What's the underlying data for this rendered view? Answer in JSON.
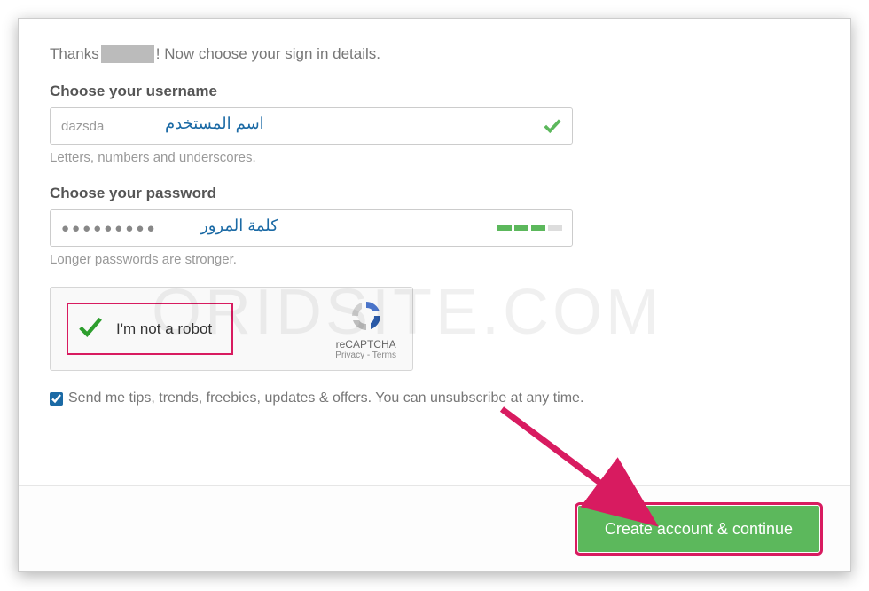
{
  "greeting": {
    "prefix": "Thanks",
    "suffix": "! Now choose your sign in details."
  },
  "username": {
    "label": "Choose your username",
    "value": "dazsda",
    "arabic": "اسم المستخدم",
    "hint": "Letters, numbers and underscores."
  },
  "password": {
    "label": "Choose your password",
    "masked": "●●●●●●●●●",
    "arabic": "كلمة المرور",
    "hint": "Longer passwords are stronger."
  },
  "captcha": {
    "text": "I'm not a robot",
    "brand": "reCAPTCHA",
    "links": "Privacy - Terms"
  },
  "tips": {
    "checked": true,
    "label": "Send me tips, trends, freebies, updates & offers. You can unsubscribe at any time."
  },
  "submit": {
    "label": "Create account & continue"
  },
  "watermark": "ORIDSITE.COM"
}
